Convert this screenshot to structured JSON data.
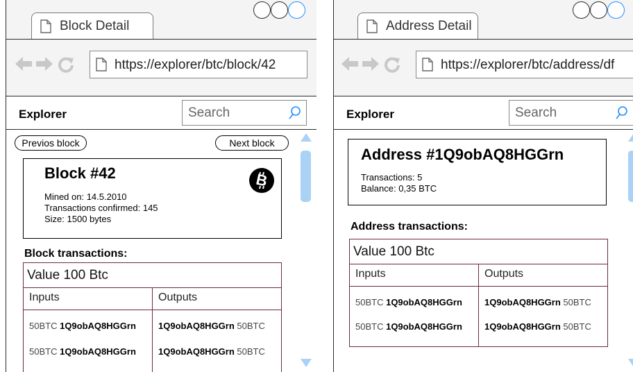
{
  "colors": {
    "accent": "#1f8fff",
    "scroll_thumb": "#a9d2f5",
    "table_border": "#6b2a3a"
  },
  "window1": {
    "tab_title": "Block Detail",
    "url": "https://explorer/btc/block/42",
    "app_title": "Explorer",
    "search_placeholder": "Search",
    "prev_button": "Previos block",
    "next_button": "Next block",
    "card": {
      "title": "Block #42",
      "mined_on": "Mined on: 14.5.2010",
      "tx_confirmed": "Transactions confirmed: 145",
      "size": "Size: 1500 bytes",
      "icon": "bitcoin-icon"
    },
    "section_title": "Block transactions:",
    "table": {
      "value": "Value 100 Btc",
      "inputs_header": "Inputs",
      "outputs_header": "Outputs",
      "rows": [
        {
          "in_amount": "50BTC",
          "in_address": "1Q9obAQ8HGGrn",
          "out_address": "1Q9obAQ8HGGrn",
          "out_amount": "50BTC"
        },
        {
          "in_amount": "50BTC",
          "in_address": "1Q9obAQ8HGGrn",
          "out_address": "1Q9obAQ8HGGrn",
          "out_amount": "50BTC"
        }
      ]
    }
  },
  "window2": {
    "tab_title": "Address Detail",
    "url": "https://explorer/btc/address/df",
    "app_title": "Explorer",
    "search_placeholder": "Search",
    "card": {
      "title": "Address #1Q9obAQ8HGGrn",
      "transactions": "Transactions: 5",
      "balance": "Balance: 0,35 BTC"
    },
    "section_title": "Address transactions:",
    "table": {
      "value": "Value 100 Btc",
      "inputs_header": "Inputs",
      "outputs_header": "Outputs",
      "rows": [
        {
          "in_amount": "50BTC",
          "in_address": "1Q9obAQ8HGGrn",
          "out_address": "1Q9obAQ8HGGrn",
          "out_amount": "50BTC"
        },
        {
          "in_amount": "50BTC",
          "in_address": "1Q9obAQ8HGGrn",
          "out_address": "1Q9obAQ8HGGrn",
          "out_amount": "50BTC"
        }
      ]
    }
  }
}
